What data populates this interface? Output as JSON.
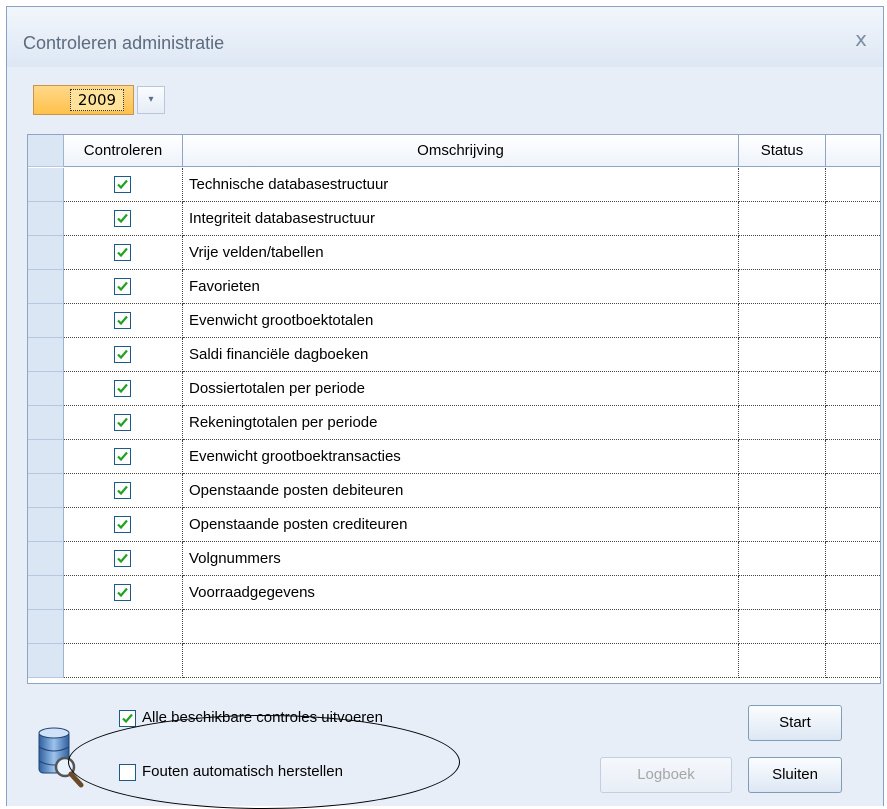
{
  "window": {
    "title": "Controleren administratie",
    "close_glyph": "x"
  },
  "year_selector": {
    "value": "2009",
    "arrow_glyph": "▾"
  },
  "grid": {
    "columns": [
      "Controleren",
      "Omschrijving",
      "Status"
    ],
    "rows": [
      {
        "checked": true,
        "description": "Technische databasestructuur",
        "status": ""
      },
      {
        "checked": true,
        "description": "Integriteit databasestructuur",
        "status": ""
      },
      {
        "checked": true,
        "description": "Vrije velden/tabellen",
        "status": ""
      },
      {
        "checked": true,
        "description": "Favorieten",
        "status": ""
      },
      {
        "checked": true,
        "description": "Evenwicht grootboektotalen",
        "status": ""
      },
      {
        "checked": true,
        "description": "Saldi financiële dagboeken",
        "status": ""
      },
      {
        "checked": true,
        "description": "Dossiertotalen per periode",
        "status": ""
      },
      {
        "checked": true,
        "description": "Rekeningtotalen per periode",
        "status": ""
      },
      {
        "checked": true,
        "description": "Evenwicht grootboektransacties",
        "status": ""
      },
      {
        "checked": true,
        "description": "Openstaande posten debiteuren",
        "status": ""
      },
      {
        "checked": true,
        "description": "Openstaande posten crediteuren",
        "status": ""
      },
      {
        "checked": true,
        "description": "Volgnummers",
        "status": ""
      },
      {
        "checked": true,
        "description": "Voorraadgegevens",
        "status": ""
      }
    ],
    "empty_rows": 2
  },
  "options": {
    "run_all": {
      "label": "Alle beschikbare controles uitvoeren",
      "checked": true
    },
    "auto_fix": {
      "label": "Fouten automatisch herstellen",
      "checked": false
    }
  },
  "buttons": {
    "start": "Start",
    "logboek": "Logboek",
    "sluiten": "Sluiten"
  },
  "icons": {
    "bottom_left": "database-search-icon",
    "close": "close-icon",
    "dropdown": "chevron-down-icon"
  }
}
